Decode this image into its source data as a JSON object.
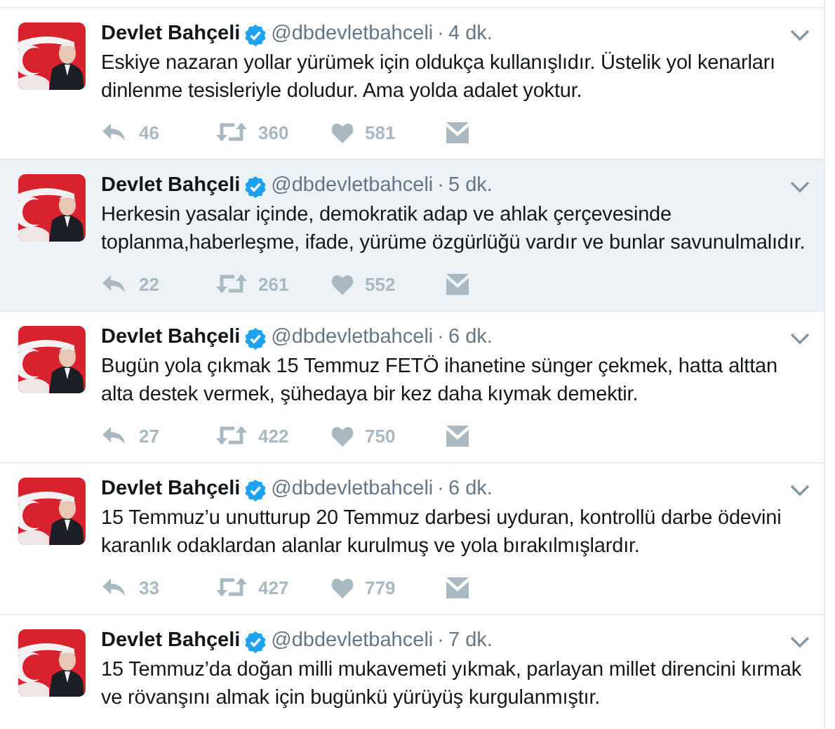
{
  "tweets": [
    {
      "name": "Devlet Bahçeli",
      "verified": true,
      "handle": "@dbdevletbahceli",
      "separator": "·",
      "time": "4 dk.",
      "highlighted": false,
      "text": "Eskiye nazaran yollar yürümek için oldukça kullanışlıdır. Üstelik yol kenarları dinlenme tesisleriyle doludur. Ama yolda adalet yoktur.",
      "replies": "46",
      "retweets": "360",
      "likes": "581"
    },
    {
      "name": "Devlet Bahçeli",
      "verified": true,
      "handle": "@dbdevletbahceli",
      "separator": "·",
      "time": "5 dk.",
      "highlighted": true,
      "text": "Herkesin yasalar içinde, demokratik adap ve ahlak çerçevesinde toplanma,haberleşme, ifade, yürüme özgürlüğü vardır ve bunlar savunulmalıdır.",
      "replies": "22",
      "retweets": "261",
      "likes": "552"
    },
    {
      "name": "Devlet Bahçeli",
      "verified": true,
      "handle": "@dbdevletbahceli",
      "separator": "·",
      "time": "6 dk.",
      "highlighted": false,
      "text": "Bugün yola çıkmak 15 Temmuz FETÖ ihanetine sünger çekmek, hatta alttan alta destek vermek, şühedaya bir kez daha kıymak demektir.",
      "replies": "27",
      "retweets": "422",
      "likes": "750"
    },
    {
      "name": "Devlet Bahçeli",
      "verified": true,
      "handle": "@dbdevletbahceli",
      "separator": "·",
      "time": "6 dk.",
      "highlighted": false,
      "text": "15 Temmuz’u unutturup 20 Temmuz darbesi uyduran, kontrollü darbe ödevini karanlık odaklardan alanlar kurulmuş ve yola bırakılmışlardır.",
      "replies": "33",
      "retweets": "427",
      "likes": "779"
    },
    {
      "name": "Devlet Bahçeli",
      "verified": true,
      "handle": "@dbdevletbahceli",
      "separator": "·",
      "time": "7 dk.",
      "highlighted": false,
      "text": "15 Temmuz’da doğan milli mukavemeti yıkmak, parlayan millet direncini kırmak ve rövanşını almak için bugünkü yürüyüş kurgulanmıştır."
    }
  ]
}
